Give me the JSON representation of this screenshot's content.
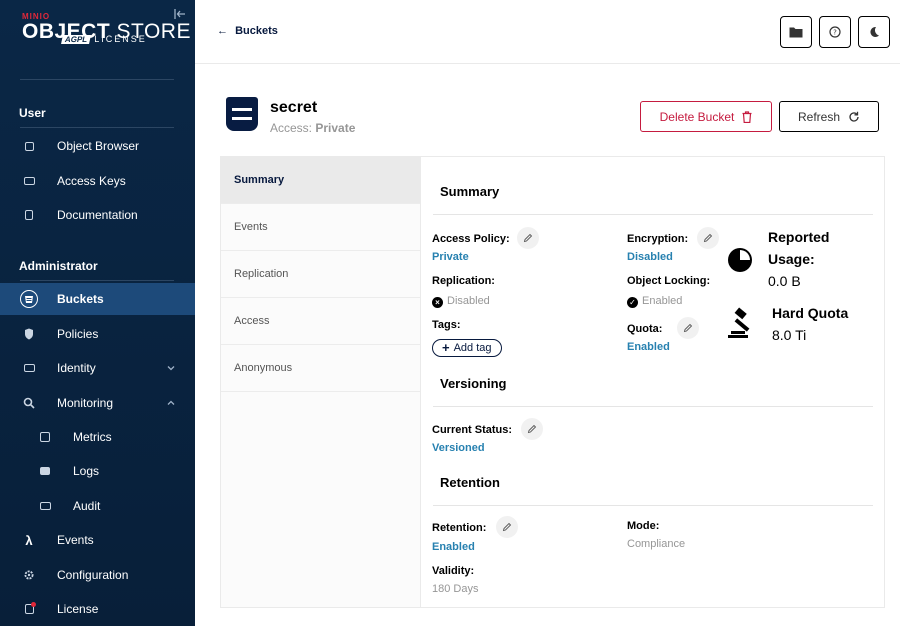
{
  "brand": {
    "minio": "MINIO",
    "object": "OBJECT",
    "store": " STORE",
    "badge": "AGPL",
    "license": "LICENSE"
  },
  "sidebar": {
    "user_section": "User",
    "user_items": [
      {
        "label": "Object Browser",
        "icon": "object-browser-icon"
      },
      {
        "label": "Access Keys",
        "icon": "access-keys-icon"
      },
      {
        "label": "Documentation",
        "icon": "documentation-icon"
      }
    ],
    "admin_section": "Administrator",
    "admin_items": [
      {
        "label": "Buckets",
        "icon": "buckets-icon",
        "active": true
      },
      {
        "label": "Policies",
        "icon": "policies-icon"
      },
      {
        "label": "Identity",
        "icon": "identity-icon",
        "chevron": "down"
      },
      {
        "label": "Monitoring",
        "icon": "monitoring-icon",
        "chevron": "up"
      }
    ],
    "monitoring_sub": [
      {
        "label": "Metrics",
        "icon": "metrics-icon"
      },
      {
        "label": "Logs",
        "icon": "logs-icon"
      },
      {
        "label": "Audit",
        "icon": "audit-icon"
      }
    ],
    "bottom_items": [
      {
        "label": "Events",
        "icon": "lambda-icon"
      },
      {
        "label": "Configuration",
        "icon": "gear-icon"
      },
      {
        "label": "License",
        "icon": "license-icon"
      }
    ]
  },
  "header": {
    "back_label": "Buckets"
  },
  "bucket": {
    "name": "secret",
    "access_label": "Access:",
    "access_value": "Private",
    "delete_label": "Delete Bucket",
    "refresh_label": "Refresh"
  },
  "tabs": [
    "Summary",
    "Events",
    "Replication",
    "Access",
    "Anonymous"
  ],
  "summary": {
    "title": "Summary",
    "access_policy_label": "Access Policy:",
    "access_policy_value": "Private",
    "replication_label": "Replication:",
    "replication_value": "Disabled",
    "tags_label": "Tags:",
    "add_tag_label": "Add tag",
    "encryption_label": "Encryption:",
    "encryption_value": "Disabled",
    "object_locking_label": "Object Locking:",
    "object_locking_value": "Enabled",
    "quota_label": "Quota:",
    "quota_value": "Enabled",
    "reported_usage_line1": "Reported",
    "reported_usage_line2": "Usage:",
    "reported_usage_value": "0.0 B",
    "hard_quota_label": "Hard Quota",
    "hard_quota_value": "8.0 Ti"
  },
  "versioning": {
    "title": "Versioning",
    "status_label": "Current Status:",
    "status_value": "Versioned"
  },
  "retention": {
    "title": "Retention",
    "retention_label": "Retention:",
    "retention_value": "Enabled",
    "mode_label": "Mode:",
    "mode_value": "Compliance",
    "validity_label": "Validity:",
    "validity_value": "180 Days"
  },
  "colors": {
    "sidebar_bg": "#0a2746",
    "active_item": "#1d4a7a",
    "link_blue": "#2781b0",
    "danger": "#c51b3f"
  }
}
